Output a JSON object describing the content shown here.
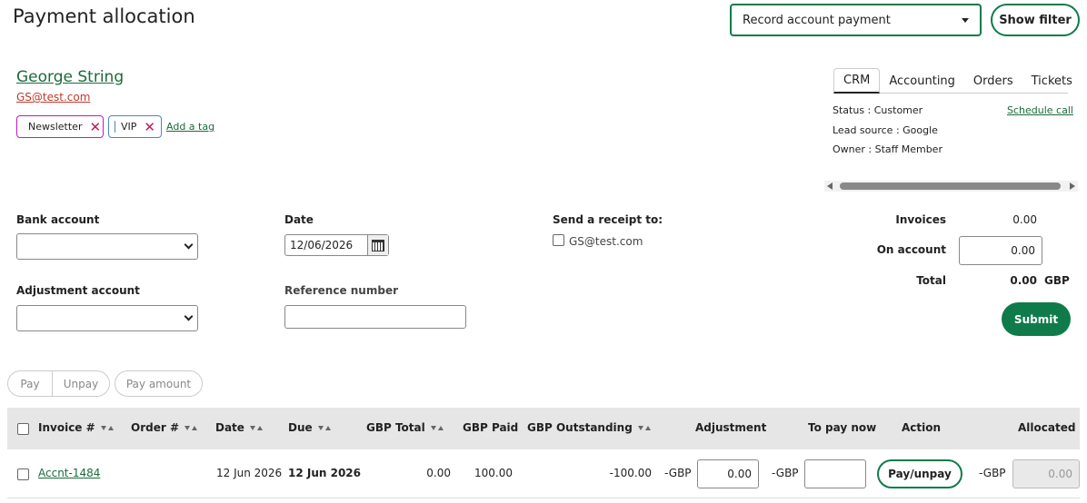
{
  "page": {
    "title": "Payment allocation"
  },
  "toolbar": {
    "action_select_value": "Record account payment",
    "show_filter_label": "Show filter"
  },
  "customer": {
    "name": "George String",
    "email": "GS@test.com",
    "tags": [
      {
        "label": "Newsletter",
        "color": "#c218c2"
      },
      {
        "label": "VIP",
        "color": "#4a86c5"
      }
    ],
    "add_tag_label": "Add a tag"
  },
  "crm_panel": {
    "tabs": [
      {
        "label": "CRM",
        "active": true
      },
      {
        "label": "Accounting",
        "active": false
      },
      {
        "label": "Orders",
        "active": false
      },
      {
        "label": "Tickets",
        "active": false
      }
    ],
    "status": "Status : Customer",
    "lead_source": "Lead source : Google",
    "owner": "Owner : Staff Member",
    "schedule_call": "Schedule call"
  },
  "form": {
    "bank_account_label": "Bank account",
    "bank_account_value": "",
    "date_label": "Date",
    "date_value": "12/06/2026",
    "receipt_label": "Send a receipt to:",
    "receipt_email": "GS@test.com",
    "receipt_checked": false,
    "adjustment_account_label": "Adjustment account",
    "adjustment_account_value": "",
    "reference_label": "Reference number",
    "reference_value": ""
  },
  "summary": {
    "invoices_label": "Invoices",
    "invoices_value": "0.00",
    "on_account_label": "On account",
    "on_account_value": "0.00",
    "total_label": "Total",
    "total_value": "0.00",
    "currency": "GBP",
    "submit_label": "Submit"
  },
  "actions": {
    "pay_label": "Pay",
    "unpay_label": "Unpay",
    "pay_amount_label": "Pay amount"
  },
  "table": {
    "headers": {
      "invoice": "Invoice #",
      "order": "Order #",
      "date": "Date",
      "due": "Due",
      "gbp_total": "GBP Total",
      "gbp_paid": "GBP Paid",
      "gbp_outstanding": "GBP Outstanding",
      "adjustment": "Adjustment",
      "to_pay_now": "To pay now",
      "action": "Action",
      "allocated": "Allocated"
    },
    "rows": [
      {
        "invoice": "Accnt-1484",
        "order": "",
        "date": "12 Jun 2026",
        "due": "12 Jun 2026",
        "gbp_total": "0.00",
        "gbp_paid": "100.00",
        "gbp_outstanding": "-100.00",
        "adjustment_prefix": "-GBP",
        "adjustment_value": "0.00",
        "to_pay_prefix": "-GBP",
        "to_pay_value": "",
        "action_label": "Pay/unpay",
        "allocated_prefix": "-GBP",
        "allocated_value": "0.00"
      }
    ]
  },
  "colors": {
    "brand_green": "#0f7b4a",
    "link_green": "#1a6b3a",
    "email_red": "#c0392b",
    "header_bg": "#e6e6e6"
  }
}
